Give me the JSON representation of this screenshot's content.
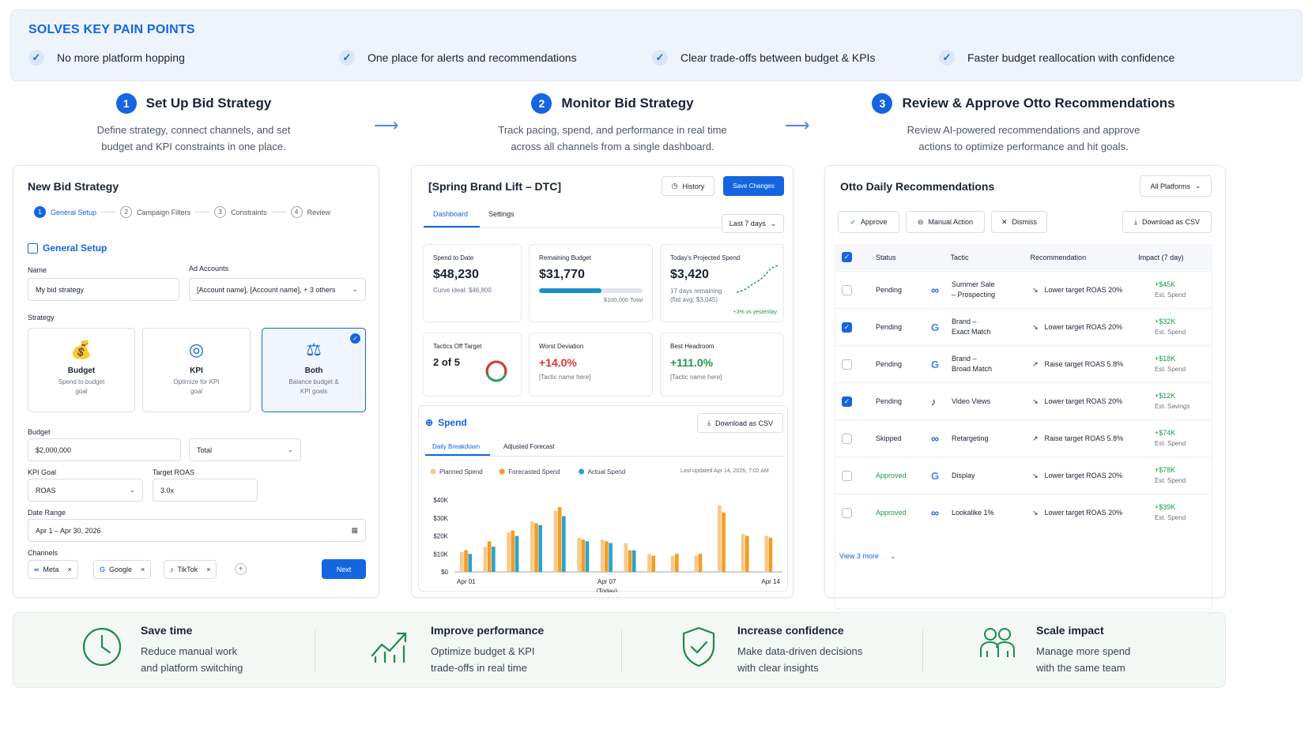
{
  "banner": {
    "title": "SOLVES KEY PAIN POINTS",
    "points": [
      "No more platform hopping",
      "One place for alerts and recommendations",
      "Clear trade-offs between budget & KPIs",
      "Faster budget reallocation with confidence"
    ]
  },
  "steps": [
    {
      "num": "1",
      "title": "Set Up Bid Strategy",
      "desc1": "Define strategy, connect channels, and set",
      "desc2": "budget and KPI constraints in one place."
    },
    {
      "num": "2",
      "title": "Monitor Bid Strategy",
      "desc1": "Track pacing, spend, and performance in real time",
      "desc2": "across all channels from a single dashboard."
    },
    {
      "num": "3",
      "title": "Review & Approve Otto Recommendations",
      "desc1": "Review AI-powered recommendations and approve",
      "desc2": "actions to optimize performance and hit goals."
    }
  ],
  "setup": {
    "title": "New Bid Strategy",
    "wizard": [
      {
        "n": "1",
        "label": "General Setup"
      },
      {
        "n": "2",
        "label": "Campaign Filters"
      },
      {
        "n": "3",
        "label": "Constraints"
      },
      {
        "n": "4",
        "label": "Review"
      }
    ],
    "section": "General Setup",
    "name_label": "Name",
    "name_value": "My bid strategy",
    "accounts_label": "Ad Accounts",
    "accounts_value": "[Account name], [Account name], + 3 others",
    "strategy_label": "Strategy",
    "strategies": [
      {
        "t": "Budget",
        "d1": "Spend to budget",
        "d2": "goal"
      },
      {
        "t": "KPI",
        "d1": "Optimize for KPI",
        "d2": "goal"
      },
      {
        "t": "Both",
        "d1": "Balance budget &",
        "d2": "KPI goals"
      }
    ],
    "budget_label": "Budget",
    "budget_value": "$2,000,000",
    "budget_type": "Total",
    "kpi_label": "KPI Goal",
    "kpi_value": "ROAS",
    "target_label": "Target ROAS",
    "target_value": "3.0x",
    "date_label": "Date Range",
    "date_value": "Apr 1 – Apr 30, 2026",
    "channels_label": "Channels",
    "channels": [
      "Meta",
      "Google",
      "TikTok"
    ],
    "next": "Next"
  },
  "monitor": {
    "title": "[Spring Brand Lift – DTC]",
    "history": "History",
    "save": "Save Changes",
    "tabs": [
      "Dashboard",
      "Settings"
    ],
    "range": "Last 7 days",
    "m1": {
      "l": "Spend to Date",
      "v": "$48,230",
      "s": "Curve ideal: $46,800"
    },
    "m2": {
      "l": "Remaining Budget",
      "v": "$31,770",
      "s": "$100,000 Total",
      "progress": 0.6
    },
    "m3": {
      "l": "Today's Projected Spend",
      "v": "$3,420",
      "s1": "17 days remaining",
      "s2": "(flat avg: $3,045)",
      "delta": "+3% vs yesterday"
    },
    "m4": {
      "l": "Tactics Off Target",
      "v": "2 of 5"
    },
    "m5": {
      "l": "Worst Deviation",
      "v": "+14.0%",
      "s": "[Tactic name here]"
    },
    "m6": {
      "l": "Best Headroom",
      "v": "+111.0%",
      "s": "[Tactic name here]"
    },
    "spend_title": "Spend",
    "download": "Download as CSV",
    "spend_tabs": [
      "Daily Breakdown",
      "Adjusted Forecast"
    ],
    "updated": "Last updated Apr 14, 2026, 7:02 AM"
  },
  "chart_data": {
    "type": "bar",
    "legend": [
      "Planned Spend",
      "Forecasted Spend",
      "Actual Spend"
    ],
    "colors": [
      "#f8c98c",
      "#f59b1f",
      "#2aa3cc"
    ],
    "yticks": [
      "$40K",
      "$30K",
      "$20K",
      "$10K",
      "$0"
    ],
    "ylim": [
      0,
      40000
    ],
    "xticks": [
      "Apr 01",
      "Apr 07",
      "Apr 14"
    ],
    "xsub": "(Today)",
    "categories": [
      "Apr 01",
      "Apr 02",
      "Apr 03",
      "Apr 04",
      "Apr 05",
      "Apr 06",
      "Apr 07",
      "Apr 08",
      "Apr 09",
      "Apr 10",
      "Apr 11",
      "Apr 12",
      "Apr 13",
      "Apr 14"
    ],
    "series": [
      {
        "name": "Planned Spend",
        "values": [
          11000,
          14000,
          22000,
          28000,
          34000,
          19000,
          18000,
          16000,
          10000,
          9000,
          9000,
          37000,
          21000,
          20000
        ]
      },
      {
        "name": "Forecasted Spend",
        "values": [
          12000,
          17000,
          23000,
          27000,
          36000,
          18000,
          17000,
          12000,
          9000,
          10000,
          10000,
          33000,
          20000,
          19000
        ]
      },
      {
        "name": "Actual Spend",
        "values": [
          10000,
          14000,
          20000,
          26000,
          31000,
          17000,
          16000,
          12000,
          null,
          null,
          null,
          null,
          null,
          null
        ]
      }
    ]
  },
  "recs": {
    "title": "Otto Daily Recommendations",
    "platforms": "All Platforms",
    "approve": "Approve",
    "manual": "Manual Action",
    "dismiss": "Dismiss",
    "download": "Download as CSV",
    "headers": [
      "Status",
      "Tactic",
      "Recommendation",
      "Impact (7 day)"
    ],
    "rows": [
      {
        "checked": false,
        "status": "Pending",
        "platform": "meta",
        "t1": "Summer Sale",
        "t2": "– Prospecting",
        "dir": "down",
        "rec": "Lower target ROAS 20%",
        "imp": "+$45K",
        "sub": "Est. Spend"
      },
      {
        "checked": true,
        "status": "Pending",
        "platform": "google",
        "t1": "Brand –",
        "t2": "Exact Match",
        "dir": "down",
        "rec": "Lower target ROAS 20%",
        "imp": "+$32K",
        "sub": "Est. Spend"
      },
      {
        "checked": false,
        "status": "Pending",
        "platform": "google",
        "t1": "Brand –",
        "t2": "Broad Match",
        "dir": "up",
        "rec": "Raise target ROAS 5.8%",
        "imp": "+$18K",
        "sub": "Est. Spend"
      },
      {
        "checked": true,
        "status": "Pending",
        "platform": "tiktok",
        "t1": "Video Views",
        "t2": "",
        "dir": "down",
        "rec": "Lower target ROAS 20%",
        "imp": "+$12K",
        "sub": "Est. Savings"
      },
      {
        "checked": false,
        "status": "Skipped",
        "platform": "meta",
        "t1": "Retargeting",
        "t2": "",
        "dir": "up",
        "rec": "Raise target ROAS 5.8%",
        "imp": "+$74K",
        "sub": "Est. Spend"
      },
      {
        "checked": false,
        "status": "Approved",
        "platform": "google",
        "t1": "Display",
        "t2": "",
        "dir": "down",
        "rec": "Lower target ROAS 20%",
        "imp": "+$78K",
        "sub": "Est. Spend"
      },
      {
        "checked": false,
        "status": "Approved",
        "platform": "meta",
        "t1": "Lookalike 1%",
        "t2": "",
        "dir": "down",
        "rec": "Lower target ROAS 20%",
        "imp": "+$39K",
        "sub": "Est. Spend"
      }
    ],
    "more": "View 3 more"
  },
  "benefits": [
    {
      "icon": "clock-icon",
      "t": "Save time",
      "d1": "Reduce manual work",
      "d2": "and platform switching"
    },
    {
      "icon": "chart-up-icon",
      "t": "Improve performance",
      "d1": "Optimize budget & KPI",
      "d2": "trade-offs in real time"
    },
    {
      "icon": "shield-icon",
      "t": "Increase confidence",
      "d1": "Make data-driven decisions",
      "d2": "with clear insights"
    },
    {
      "icon": "team-icon",
      "t": "Scale impact",
      "d1": "Manage more spend",
      "d2": "with the same team"
    }
  ]
}
